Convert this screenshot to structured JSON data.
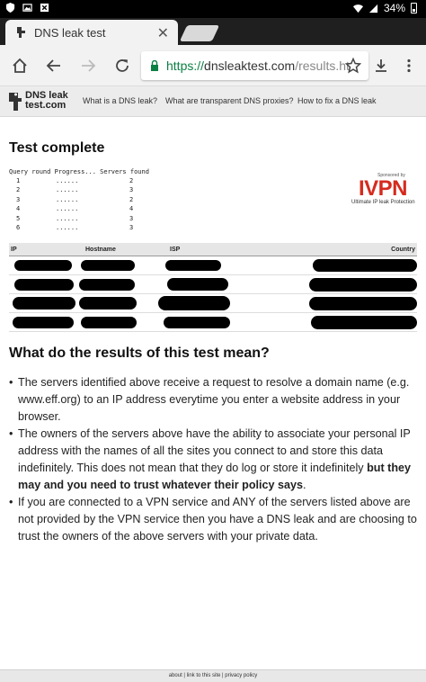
{
  "status_bar": {
    "battery": "34%"
  },
  "tab": {
    "title": "DNS leak test"
  },
  "address_bar": {
    "scheme": "https://",
    "host": "dnsleaktest.com",
    "path": "/results.ht"
  },
  "site_nav": {
    "logo_line1": "DNS leak",
    "logo_line2": "test.com",
    "links": [
      "What is a DNS leak?",
      "What are transparent DNS proxies?",
      "How to fix a DNS leak"
    ]
  },
  "main": {
    "heading": "Test complete",
    "progress_header": "Query round  Progress...  Servers found",
    "rounds": [
      {
        "round": "1",
        "progress": "......",
        "servers": "2"
      },
      {
        "round": "2",
        "progress": "......",
        "servers": "3"
      },
      {
        "round": "3",
        "progress": "......",
        "servers": "2"
      },
      {
        "round": "4",
        "progress": "......",
        "servers": "4"
      },
      {
        "round": "5",
        "progress": "......",
        "servers": "3"
      },
      {
        "round": "6",
        "progress": "......",
        "servers": "3"
      }
    ],
    "sponsor": {
      "sponsored_by": "Sponsored by",
      "brand": "IVPN",
      "tagline": "Ultimate IP leak Protection"
    },
    "results_table": {
      "columns": [
        "IP",
        "Hostname",
        "ISP",
        "Country"
      ]
    },
    "section_heading": "What do the results of this test mean?",
    "bullets": [
      {
        "text": "The servers identified above receive a request to resolve a domain name (e.g. www.eff.org) to an IP address everytime you enter a website address in your browser."
      },
      {
        "text": "The owners of the servers above have the ability to associate your personal IP address with the names of all the sites you connect to and store this data indefinitely. This does not mean that they do log or store it indefinitely ",
        "bold": "but they may and you need to trust whatever their policy says",
        "tail": "."
      },
      {
        "text": "If you are connected to a VPN service and ANY of the servers listed above are not provided by the VPN service then you have a DNS leak and are choosing to trust the owners of the above servers with your private data."
      }
    ]
  },
  "footer": {
    "text": "about | link to this site | privacy policy"
  }
}
